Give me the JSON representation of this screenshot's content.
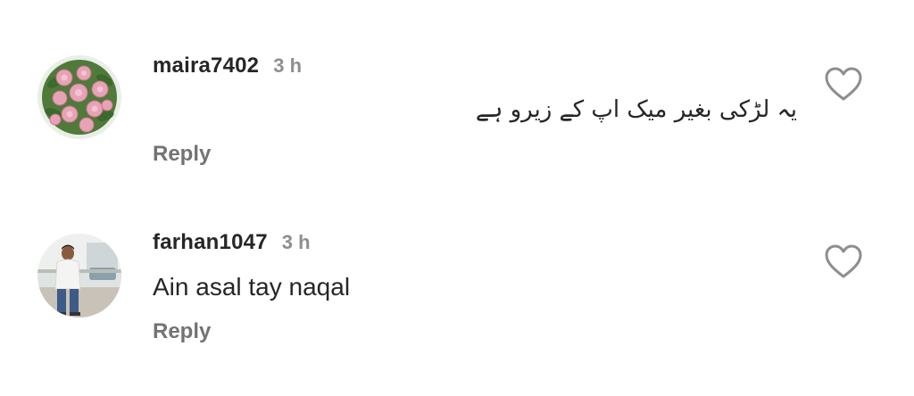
{
  "comments": [
    {
      "username": "maira7402",
      "time": "3 h",
      "text": "یہ لڑکی بغیر میک اپ کے زیرو ہے",
      "reply_label": "Reply",
      "avatar_icon": "roses-bouquet-avatar",
      "like_icon": "heart-outline-icon"
    },
    {
      "username": "farhan1047",
      "time": "3 h",
      "text": "Ain asal tay naqal",
      "reply_label": "Reply",
      "avatar_icon": "man-portrait-avatar",
      "like_icon": "heart-outline-icon"
    }
  ],
  "colors": {
    "text_primary": "#262626",
    "text_secondary": "#8e8e8e",
    "reply": "#737373",
    "heart_stroke": "#8e8e8e"
  }
}
